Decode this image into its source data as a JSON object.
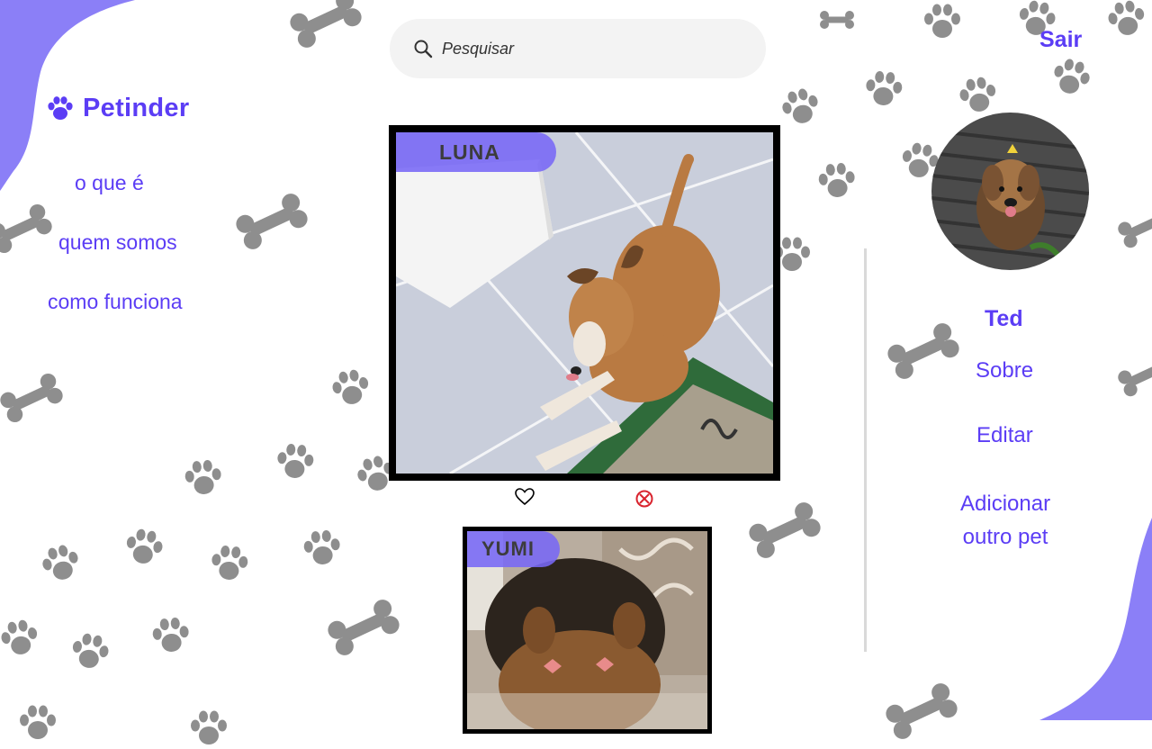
{
  "brand": {
    "label": "Petinder",
    "icon": "paw-icon"
  },
  "nav": {
    "items": [
      "o que é",
      "quem somos",
      "como funciona"
    ]
  },
  "search": {
    "placeholder": "Pesquisar",
    "icon": "search-icon"
  },
  "cards": [
    {
      "name": "LUNA",
      "like_icon": "heart-icon",
      "dislike_icon": "close-circle-icon"
    },
    {
      "name": "YUMI"
    }
  ],
  "profile": {
    "logout_label": "Sair",
    "name": "Ted",
    "menu": [
      "Sobre",
      "Editar",
      "Adicionar",
      "outro pet"
    ]
  },
  "colors": {
    "accent": "#5b3df5",
    "blob": "#8b7ff7",
    "deco": "#8e8e8e",
    "tag": "#7868f6",
    "dislike": "#d9232e"
  }
}
